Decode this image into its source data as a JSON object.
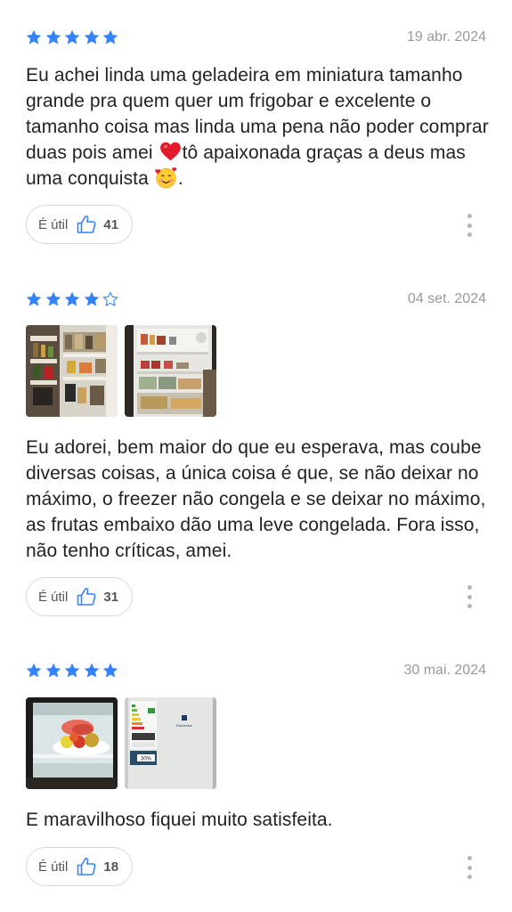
{
  "colors": {
    "star_filled": "#3483fa",
    "star_empty": "#3483fa",
    "date": "#999999",
    "text": "#222222"
  },
  "reviews": [
    {
      "rating": 5,
      "date": "19 abr. 2024",
      "text_parts": [
        "Eu achei linda uma geladeira em miniatura tamanho grande pra quem quer um frigobar e excelente o tamanho coisa mas linda uma pena não poder comprar duas pois amei ",
        "tô apaixonada graças a deus mas uma conquista ",
        "."
      ],
      "emojis": [
        "red-heart-icon",
        "smiling-face-with-hearts-icon"
      ],
      "useful_label": "É útil",
      "useful_count": "41",
      "photos": []
    },
    {
      "rating": 4,
      "date": "04 set. 2024",
      "text": "Eu adorei, bem maior do que eu esperava, mas coube diversas coisas, a única coisa é que, se não deixar no máximo, o freezer não congela e se deixar no máximo, as frutas embaixo dão uma leve congelada. Fora isso, não tenho críticas, amei.",
      "useful_label": "É útil",
      "useful_count": "31",
      "photos": [
        "fridge-door-photo",
        "fridge-interior-photo"
      ]
    },
    {
      "rating": 5,
      "date": "30 mai. 2024",
      "text": "E maravilhoso fiquei muito satisfeita.",
      "useful_label": "É útil",
      "useful_count": "18",
      "photos": [
        "fruit-bowl-photo",
        "fridge-label-photo"
      ],
      "photo_text": {
        "brand": "Electrolux",
        "badge": "30%"
      }
    }
  ]
}
